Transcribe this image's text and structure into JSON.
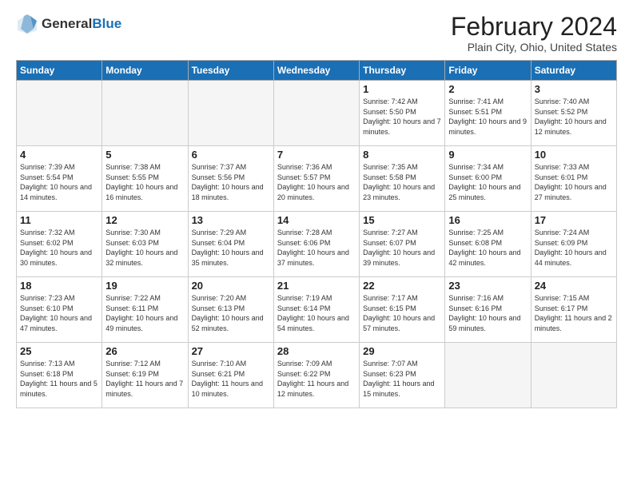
{
  "logo": {
    "general": "General",
    "blue": "Blue"
  },
  "title": "February 2024",
  "location": "Plain City, Ohio, United States",
  "days_header": [
    "Sunday",
    "Monday",
    "Tuesday",
    "Wednesday",
    "Thursday",
    "Friday",
    "Saturday"
  ],
  "weeks": [
    [
      {
        "day": "",
        "sunrise": "",
        "sunset": "",
        "daylight": ""
      },
      {
        "day": "",
        "sunrise": "",
        "sunset": "",
        "daylight": ""
      },
      {
        "day": "",
        "sunrise": "",
        "sunset": "",
        "daylight": ""
      },
      {
        "day": "",
        "sunrise": "",
        "sunset": "",
        "daylight": ""
      },
      {
        "day": "1",
        "sunrise": "Sunrise: 7:42 AM",
        "sunset": "Sunset: 5:50 PM",
        "daylight": "Daylight: 10 hours and 7 minutes."
      },
      {
        "day": "2",
        "sunrise": "Sunrise: 7:41 AM",
        "sunset": "Sunset: 5:51 PM",
        "daylight": "Daylight: 10 hours and 9 minutes."
      },
      {
        "day": "3",
        "sunrise": "Sunrise: 7:40 AM",
        "sunset": "Sunset: 5:52 PM",
        "daylight": "Daylight: 10 hours and 12 minutes."
      }
    ],
    [
      {
        "day": "4",
        "sunrise": "Sunrise: 7:39 AM",
        "sunset": "Sunset: 5:54 PM",
        "daylight": "Daylight: 10 hours and 14 minutes."
      },
      {
        "day": "5",
        "sunrise": "Sunrise: 7:38 AM",
        "sunset": "Sunset: 5:55 PM",
        "daylight": "Daylight: 10 hours and 16 minutes."
      },
      {
        "day": "6",
        "sunrise": "Sunrise: 7:37 AM",
        "sunset": "Sunset: 5:56 PM",
        "daylight": "Daylight: 10 hours and 18 minutes."
      },
      {
        "day": "7",
        "sunrise": "Sunrise: 7:36 AM",
        "sunset": "Sunset: 5:57 PM",
        "daylight": "Daylight: 10 hours and 20 minutes."
      },
      {
        "day": "8",
        "sunrise": "Sunrise: 7:35 AM",
        "sunset": "Sunset: 5:58 PM",
        "daylight": "Daylight: 10 hours and 23 minutes."
      },
      {
        "day": "9",
        "sunrise": "Sunrise: 7:34 AM",
        "sunset": "Sunset: 6:00 PM",
        "daylight": "Daylight: 10 hours and 25 minutes."
      },
      {
        "day": "10",
        "sunrise": "Sunrise: 7:33 AM",
        "sunset": "Sunset: 6:01 PM",
        "daylight": "Daylight: 10 hours and 27 minutes."
      }
    ],
    [
      {
        "day": "11",
        "sunrise": "Sunrise: 7:32 AM",
        "sunset": "Sunset: 6:02 PM",
        "daylight": "Daylight: 10 hours and 30 minutes."
      },
      {
        "day": "12",
        "sunrise": "Sunrise: 7:30 AM",
        "sunset": "Sunset: 6:03 PM",
        "daylight": "Daylight: 10 hours and 32 minutes."
      },
      {
        "day": "13",
        "sunrise": "Sunrise: 7:29 AM",
        "sunset": "Sunset: 6:04 PM",
        "daylight": "Daylight: 10 hours and 35 minutes."
      },
      {
        "day": "14",
        "sunrise": "Sunrise: 7:28 AM",
        "sunset": "Sunset: 6:06 PM",
        "daylight": "Daylight: 10 hours and 37 minutes."
      },
      {
        "day": "15",
        "sunrise": "Sunrise: 7:27 AM",
        "sunset": "Sunset: 6:07 PM",
        "daylight": "Daylight: 10 hours and 39 minutes."
      },
      {
        "day": "16",
        "sunrise": "Sunrise: 7:25 AM",
        "sunset": "Sunset: 6:08 PM",
        "daylight": "Daylight: 10 hours and 42 minutes."
      },
      {
        "day": "17",
        "sunrise": "Sunrise: 7:24 AM",
        "sunset": "Sunset: 6:09 PM",
        "daylight": "Daylight: 10 hours and 44 minutes."
      }
    ],
    [
      {
        "day": "18",
        "sunrise": "Sunrise: 7:23 AM",
        "sunset": "Sunset: 6:10 PM",
        "daylight": "Daylight: 10 hours and 47 minutes."
      },
      {
        "day": "19",
        "sunrise": "Sunrise: 7:22 AM",
        "sunset": "Sunset: 6:11 PM",
        "daylight": "Daylight: 10 hours and 49 minutes."
      },
      {
        "day": "20",
        "sunrise": "Sunrise: 7:20 AM",
        "sunset": "Sunset: 6:13 PM",
        "daylight": "Daylight: 10 hours and 52 minutes."
      },
      {
        "day": "21",
        "sunrise": "Sunrise: 7:19 AM",
        "sunset": "Sunset: 6:14 PM",
        "daylight": "Daylight: 10 hours and 54 minutes."
      },
      {
        "day": "22",
        "sunrise": "Sunrise: 7:17 AM",
        "sunset": "Sunset: 6:15 PM",
        "daylight": "Daylight: 10 hours and 57 minutes."
      },
      {
        "day": "23",
        "sunrise": "Sunrise: 7:16 AM",
        "sunset": "Sunset: 6:16 PM",
        "daylight": "Daylight: 10 hours and 59 minutes."
      },
      {
        "day": "24",
        "sunrise": "Sunrise: 7:15 AM",
        "sunset": "Sunset: 6:17 PM",
        "daylight": "Daylight: 11 hours and 2 minutes."
      }
    ],
    [
      {
        "day": "25",
        "sunrise": "Sunrise: 7:13 AM",
        "sunset": "Sunset: 6:18 PM",
        "daylight": "Daylight: 11 hours and 5 minutes."
      },
      {
        "day": "26",
        "sunrise": "Sunrise: 7:12 AM",
        "sunset": "Sunset: 6:19 PM",
        "daylight": "Daylight: 11 hours and 7 minutes."
      },
      {
        "day": "27",
        "sunrise": "Sunrise: 7:10 AM",
        "sunset": "Sunset: 6:21 PM",
        "daylight": "Daylight: 11 hours and 10 minutes."
      },
      {
        "day": "28",
        "sunrise": "Sunrise: 7:09 AM",
        "sunset": "Sunset: 6:22 PM",
        "daylight": "Daylight: 11 hours and 12 minutes."
      },
      {
        "day": "29",
        "sunrise": "Sunrise: 7:07 AM",
        "sunset": "Sunset: 6:23 PM",
        "daylight": "Daylight: 11 hours and 15 minutes."
      },
      {
        "day": "",
        "sunrise": "",
        "sunset": "",
        "daylight": ""
      },
      {
        "day": "",
        "sunrise": "",
        "sunset": "",
        "daylight": ""
      }
    ]
  ]
}
